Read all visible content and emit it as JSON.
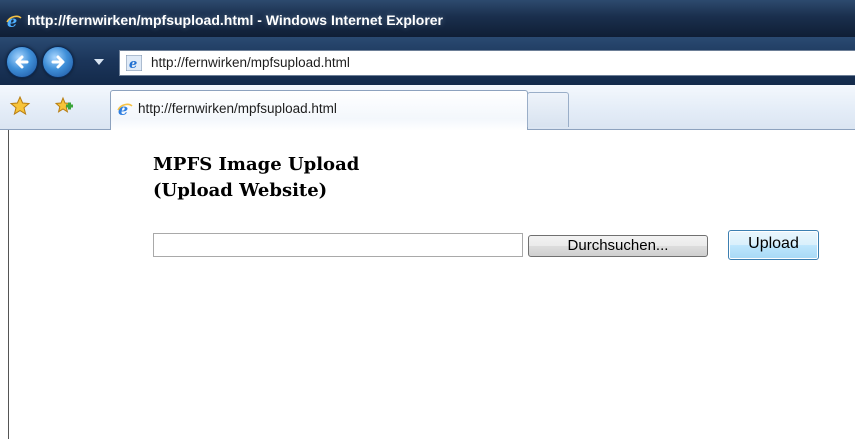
{
  "window": {
    "title": "http://fernwirken/mpfsupload.html - Windows Internet Explorer",
    "icon": "ie-icon"
  },
  "navigation": {
    "back_icon": "back-arrow-icon",
    "forward_icon": "forward-arrow-icon",
    "address": "http://fernwirken/mpfsupload.html"
  },
  "tabs": {
    "favorites_icon": "favorites-star-icon",
    "add_favorite_icon": "add-favorite-icon",
    "active_tab_label": "http://fernwirken/mpfsupload.html"
  },
  "page": {
    "heading_line1": "MPFS Image Upload",
    "heading_line2": "(Upload Website)",
    "file_input_value": "",
    "browse_label": "Durchsuchen...",
    "upload_label": "Upload"
  },
  "colors": {
    "titlebar": "#1a2f4d",
    "accent": "#3c7fb1"
  }
}
